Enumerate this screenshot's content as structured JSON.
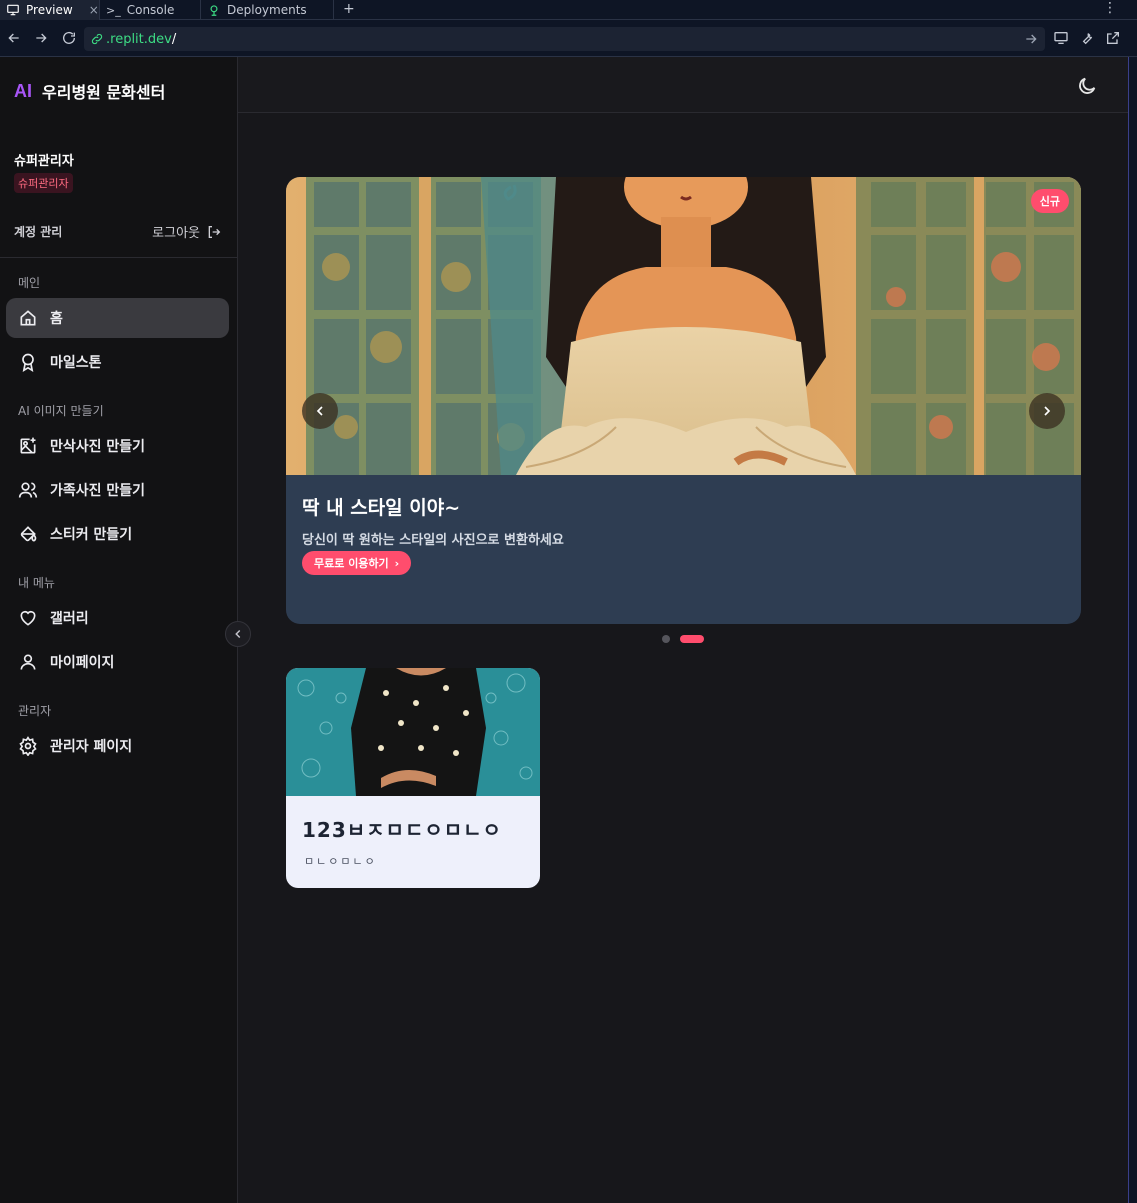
{
  "browser": {
    "tabs": [
      {
        "label": "Preview",
        "close": "×"
      },
      {
        "label": "Console"
      },
      {
        "label": "Deployments"
      }
    ],
    "add_tab": "+",
    "more": "⋮",
    "url_host": ".replit.dev",
    "url_path": "/"
  },
  "sidebar": {
    "brand_ai": "AI",
    "brand_name": "우리병원 문화센터",
    "user_name": "슈퍼관리자",
    "role_badge": "슈퍼관리자",
    "account_label": "계정 관리",
    "logout_label": "로그아웃",
    "sections": {
      "main": "메인",
      "ai_images": "AI 이미지 만들기",
      "my_menu": "내 메뉴",
      "admin": "관리자"
    },
    "items": {
      "home": "홈",
      "milestone": "마일스톤",
      "maternity": "만삭사진 만들기",
      "family": "가족사진 만들기",
      "sticker": "스티커 만들기",
      "gallery": "갤러리",
      "mypage": "마이페이지",
      "admin_page": "관리자 페이지"
    }
  },
  "banner": {
    "badge": "신규",
    "title": "딱 내 스타일 이야~",
    "description": "당신이 딱 원하는 스타일의 사진으로 변환하세요",
    "cta_label": "무료로 이용하기",
    "cta_arrow": "›",
    "slides_total": 2,
    "active_slide": 2
  },
  "card": {
    "title": "123ㅂㅈㅁㄷㅇㅁㄴㅇ",
    "subtitle": "ㅁㄴㅇㅁㄴㅇ"
  },
  "colors": {
    "accent_pink": "#ff4d6d",
    "brand_purple": "#a855f7",
    "url_green": "#3ddc84"
  }
}
